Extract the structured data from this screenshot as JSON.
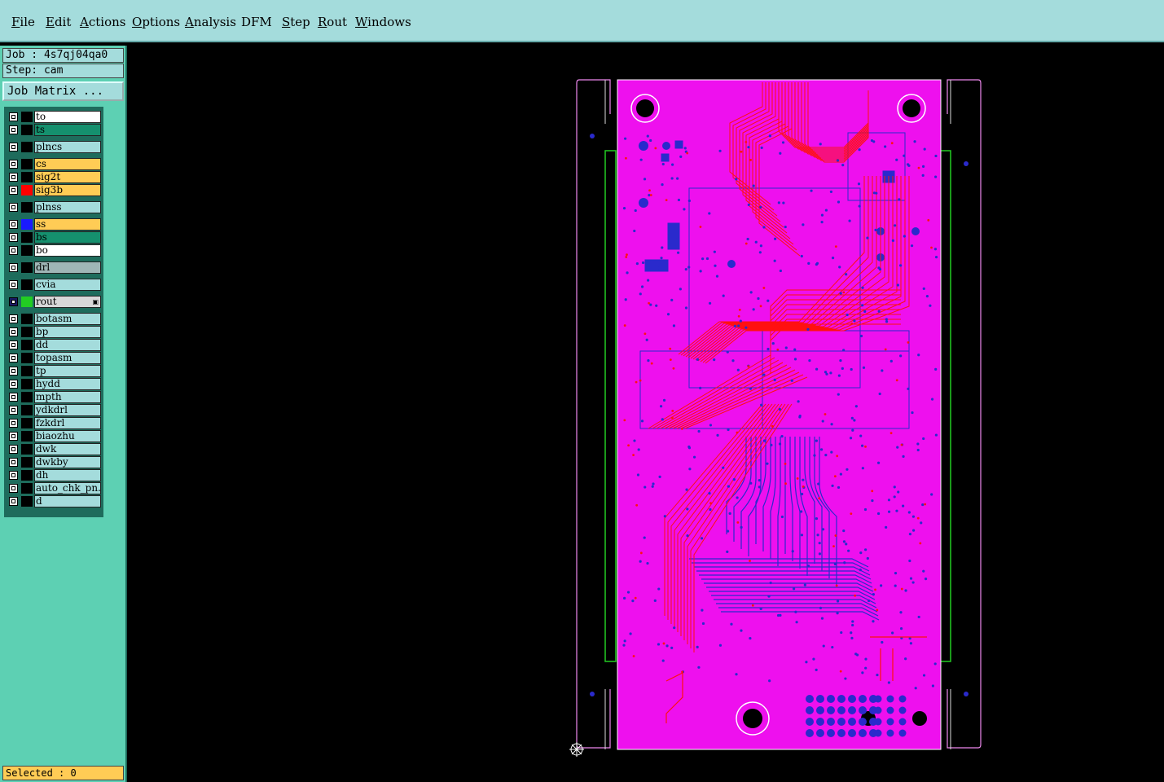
{
  "menu": [
    {
      "label": "File",
      "mnemonic_index": 0
    },
    {
      "label": "Edit",
      "mnemonic_index": 0
    },
    {
      "label": "Actions",
      "mnemonic_index": 0
    },
    {
      "label": "Options",
      "mnemonic_index": 0
    },
    {
      "label": "Analysis",
      "mnemonic_index": 0
    },
    {
      "label": "DFM",
      "mnemonic_index": -1
    },
    {
      "label": "Step",
      "mnemonic_index": 0
    },
    {
      "label": "Rout",
      "mnemonic_index": 0
    },
    {
      "label": "Windows",
      "mnemonic_index": 0
    }
  ],
  "job": {
    "text": "Job : 4s7qj04qa0"
  },
  "step": {
    "text": "Step: cam"
  },
  "job_matrix_button": "Job Matrix ...",
  "layers": [
    {
      "name": "to",
      "bg": "#ffffff",
      "swatch": "#000000"
    },
    {
      "name": "ts",
      "bg": "#15906e",
      "swatch": "#000000"
    },
    {
      "name": "plncs",
      "bg": "#a4dcdc",
      "swatch": "#000000"
    },
    {
      "name": "cs",
      "bg": "#ffcc55",
      "swatch": "#000000"
    },
    {
      "name": "sig2t",
      "bg": "#ffcc55",
      "swatch": "#000000"
    },
    {
      "name": "sig3b",
      "bg": "#ffcc55",
      "swatch": "#ff0000"
    },
    {
      "name": "plnss",
      "bg": "#a4dcdc",
      "swatch": "#000000"
    },
    {
      "name": "ss",
      "bg": "#ffcc55",
      "swatch": "#1a1aff"
    },
    {
      "name": "bs",
      "bg": "#15906e",
      "swatch": "#000000"
    },
    {
      "name": "bo",
      "bg": "#ffffff",
      "swatch": "#000000"
    },
    {
      "name": "drl",
      "bg": "#9fb6b6",
      "swatch": "#000000"
    },
    {
      "name": "cvia",
      "bg": "#a4dcdc",
      "swatch": "#000000"
    },
    {
      "name": "rout",
      "bg": "#d8d8d8",
      "swatch": "#22cc22",
      "active": true
    },
    {
      "name": "botasm",
      "bg": "#a4dcdc",
      "swatch": "#000000"
    },
    {
      "name": "bp",
      "bg": "#a4dcdc",
      "swatch": "#000000"
    },
    {
      "name": "dd",
      "bg": "#a4dcdc",
      "swatch": "#000000"
    },
    {
      "name": "topasm",
      "bg": "#a4dcdc",
      "swatch": "#000000"
    },
    {
      "name": "tp",
      "bg": "#a4dcdc",
      "swatch": "#000000"
    },
    {
      "name": "hydd",
      "bg": "#a4dcdc",
      "swatch": "#000000"
    },
    {
      "name": "mpth",
      "bg": "#a4dcdc",
      "swatch": "#000000"
    },
    {
      "name": "ydkdrl",
      "bg": "#a4dcdc",
      "swatch": "#000000"
    },
    {
      "name": "fzkdrl",
      "bg": "#a4dcdc",
      "swatch": "#000000"
    },
    {
      "name": "biaozhu",
      "bg": "#a4dcdc",
      "swatch": "#000000"
    },
    {
      "name": "dwk",
      "bg": "#a4dcdc",
      "swatch": "#000000"
    },
    {
      "name": "dwkby",
      "bg": "#a4dcdc",
      "swatch": "#000000"
    },
    {
      "name": "dh",
      "bg": "#a4dcdc",
      "swatch": "#000000"
    },
    {
      "name": "auto_chk_pn.",
      "bg": "#a4dcdc",
      "swatch": "#000000"
    },
    {
      "name": "d",
      "bg": "#a4dcdc",
      "swatch": "#000000"
    }
  ],
  "selected": {
    "text": "Selected : 0"
  },
  "colors": {
    "board_fill": "#ee10ee",
    "trace_red": "#ff1010",
    "trace_blue": "#2a2acc",
    "outline_green": "#22cc22",
    "outline_white": "#dddddd"
  }
}
